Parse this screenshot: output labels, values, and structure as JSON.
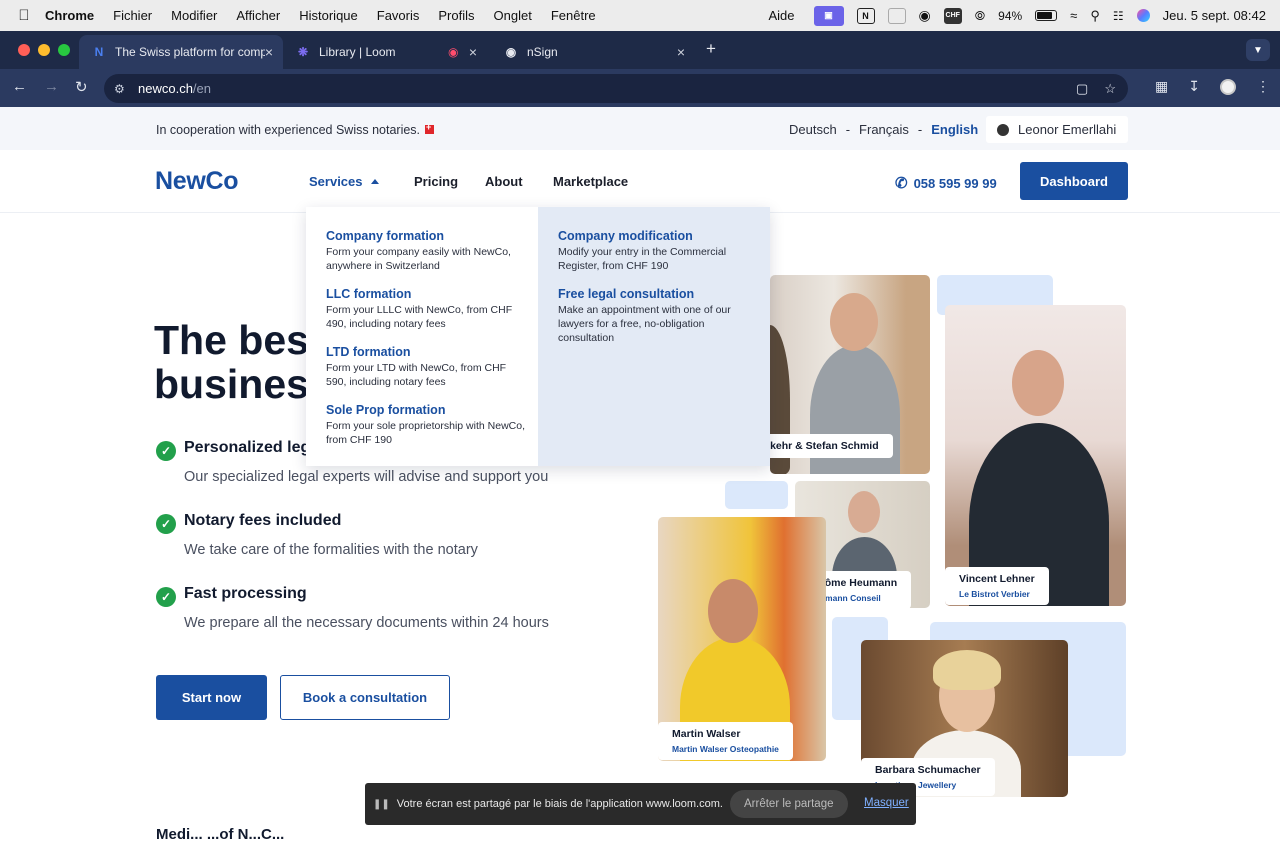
{
  "menubar": {
    "app": "Chrome",
    "items": [
      "Fichier",
      "Modifier",
      "Afficher",
      "Historique",
      "Favoris",
      "Profils",
      "Onglet",
      "Fenêtre"
    ],
    "help": "Aide",
    "battery": "94%",
    "date": "Jeu. 5 sept.",
    "time": "08:42"
  },
  "browser": {
    "tabs": [
      {
        "title": "The Swiss platform for compa"
      },
      {
        "title": "Library | Loom"
      },
      {
        "title": "nSign"
      }
    ],
    "url_host": "newco.ch",
    "url_path": "/en"
  },
  "topbar": {
    "cooperation": "In cooperation with experienced Swiss notaries.",
    "languages": [
      "Deutsch",
      "Français",
      "English"
    ],
    "active_language": "English",
    "user": "Leonor Emerllahi"
  },
  "header": {
    "logo": "NewCo",
    "nav": [
      "Services",
      "Pricing",
      "About",
      "Marketplace"
    ],
    "phone": "058 595 99 99",
    "dashboard": "Dashboard"
  },
  "dropdown": {
    "left": [
      {
        "title": "Company formation",
        "desc": "Form your company easily with NewCo, anywhere in Switzerland"
      },
      {
        "title": "LLC formation",
        "desc": "Form your LLLC with NewCo, from CHF 490, including notary fees"
      },
      {
        "title": "LTD formation",
        "desc": "Form your LTD with NewCo, from CHF 590, including notary fees"
      },
      {
        "title": "Sole Prop formation",
        "desc": "Form your sole proprietorship with NewCo, from CHF 190"
      }
    ],
    "right": [
      {
        "title": "Company modification",
        "desc": "Modify your entry in the Commercial Register, from CHF 190"
      },
      {
        "title": "Free legal consultation",
        "desc": "Make an appointment with one of our lawyers for a free, no-obligation consultation"
      }
    ]
  },
  "hero": {
    "title_line1": "The bes",
    "title_line2": "busines",
    "features": [
      {
        "title": "Personalized leg",
        "desc": "Our specialized legal experts will advise and support you"
      },
      {
        "title": "Notary fees included",
        "desc": "We take care of the formalities with the notary"
      },
      {
        "title": "Fast processing",
        "desc": "We prepare all the necessary documents within 24 hours"
      }
    ],
    "start": "Start now",
    "book": "Book a consultation",
    "next_heading": "Medi... ...of N...C..."
  },
  "testimonials": {
    "p1": {
      "name": "rkehr & Stefan Schmid"
    },
    "p2": {
      "name": "Vincent Lehner",
      "company": "Le Bistrot Verbier"
    },
    "p3": {
      "name": "Jérôme Heumann",
      "company": "Heumann Conseil"
    },
    "p4": {
      "name": "Martin Walser",
      "company": "Martin Walser Osteopathie"
    },
    "p5": {
      "name": "Barbara Schumacher",
      "company": "Lunatique Jewellery"
    }
  },
  "loom": {
    "message": "Votre écran est partagé par le biais de l'application www.loom.com.",
    "stop": "Arrêter le partage",
    "hide": "Masquer"
  },
  "colors": {
    "brand": "#1a4fa0",
    "check": "#22a04b",
    "chrome_bg": "#2b3a60"
  }
}
